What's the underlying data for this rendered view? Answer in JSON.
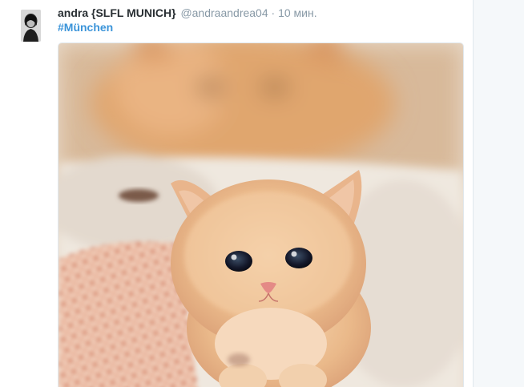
{
  "tweet": {
    "author_name": "andra {SLFL MUNICH}",
    "author_handle": "@andraandrea04",
    "separator": "·",
    "timestamp": "10 мин.",
    "hashtag": "#München",
    "avatar_icon": "user-avatar-photo",
    "media_subject": "kitten-photo"
  },
  "colors": {
    "name": "#292f33",
    "meta": "#8899a6",
    "link": "#3b94d9",
    "page_background": "#e6ecf0"
  }
}
